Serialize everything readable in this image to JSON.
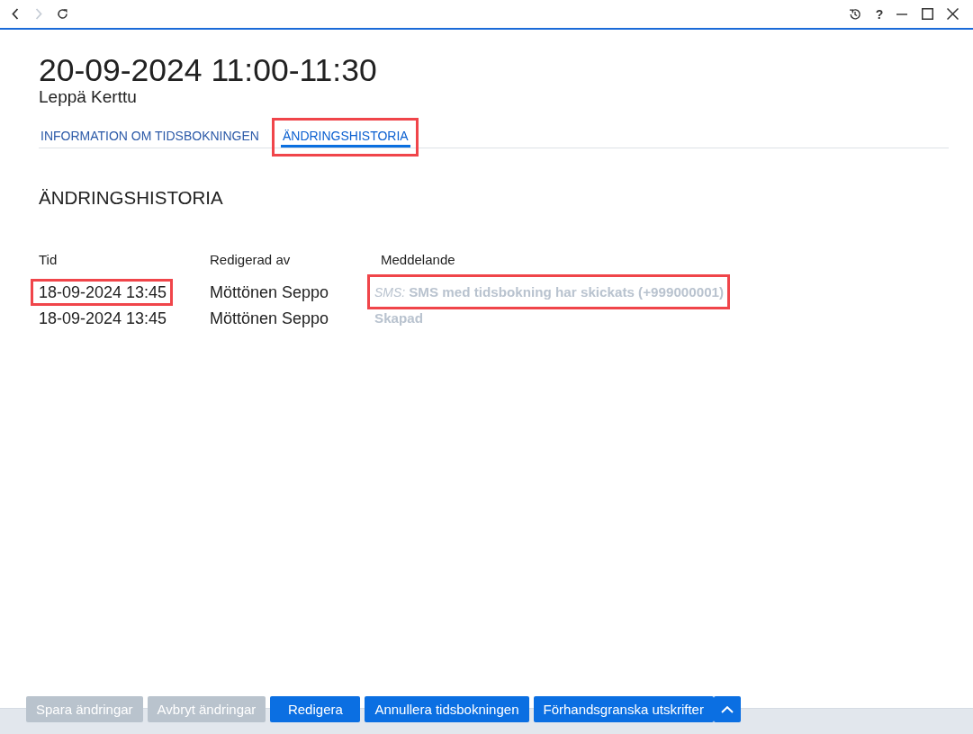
{
  "toolbar": {
    "nav": [
      {
        "kind": "back",
        "disabled": false
      },
      {
        "kind": "forward",
        "disabled": true
      },
      {
        "kind": "reload",
        "disabled": false
      }
    ],
    "help": "?"
  },
  "header": {
    "title": "20-09-2024 11:00-11:30",
    "subtitle": "Leppä Kerttu"
  },
  "tabs": [
    {
      "label": "INFORMATION OM TIDSBOKNINGEN",
      "selected": false,
      "highlighted": false
    },
    {
      "label": "ÄNDRINGSHISTORIA",
      "selected": true,
      "highlighted": true
    }
  ],
  "section": {
    "title": "ÄNDRINGSHISTORIA"
  },
  "table": {
    "columns": [
      "Tid",
      "Redigerad av",
      "Meddelande"
    ],
    "rows": [
      {
        "time": "18-09-2024 13:45",
        "time_highlighted": true,
        "editor": "Möttönen Seppo",
        "message_prefix": "SMS:",
        "message": "SMS med tidsbokning har skickats (+999000001)",
        "message_highlighted": true
      },
      {
        "time": "18-09-2024 13:45",
        "time_highlighted": false,
        "editor": "Möttönen Seppo",
        "message": "Skapad",
        "message_highlighted": false
      }
    ]
  },
  "footer": {
    "buttons": [
      {
        "kind": "text",
        "label": "Spara ändringar",
        "disabled": true
      },
      {
        "kind": "text",
        "label": "Avbryt ändringar",
        "disabled": true
      },
      {
        "kind": "text",
        "label": "Redigera",
        "disabled": false
      },
      {
        "kind": "text",
        "label": "Annullera tidsbokningen",
        "disabled": false
      },
      {
        "kind": "text",
        "label": "Förhandsgranska utskrifter",
        "disabled": false
      },
      {
        "kind": "menu",
        "disabled": false
      }
    ]
  }
}
